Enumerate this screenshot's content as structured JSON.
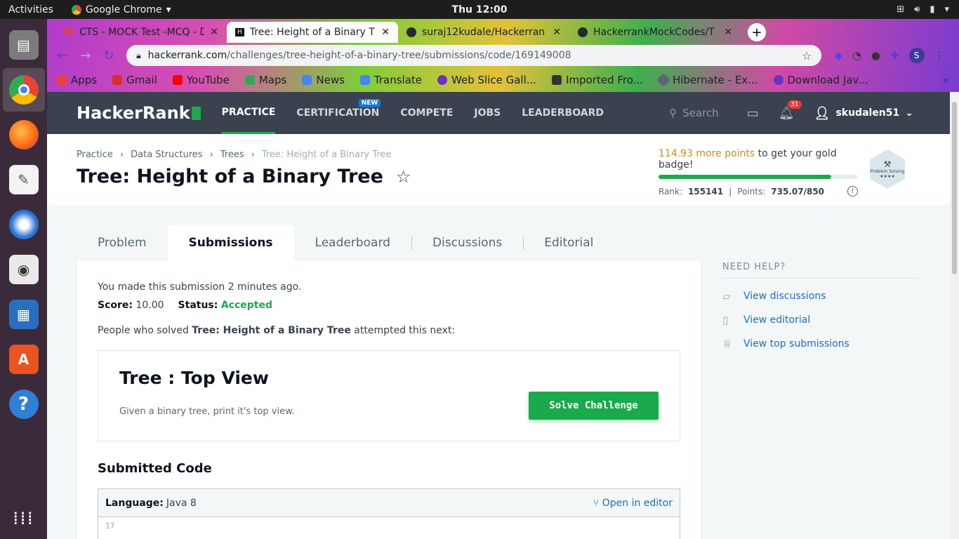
{
  "os": {
    "activities": "Activities",
    "app_name": "Google Chrome",
    "clock": "Thu 12:00"
  },
  "browser": {
    "tabs": [
      {
        "title": "CTS - MOCK Test -MCQ - D",
        "icon": "gmail-icon",
        "active": false
      },
      {
        "title": "Tree: Height of a Binary T",
        "icon": "hackerrank-icon",
        "active": true
      },
      {
        "title": "suraj12kudale/Hackerran",
        "icon": "github-icon",
        "active": false
      },
      {
        "title": "HackerrankMockCodes/T",
        "icon": "github-icon",
        "active": false
      }
    ],
    "url_host": "hackerrank.com",
    "url_path": "/challenges/tree-height-of-a-binary-tree/submissions/code/169149008",
    "profile_initial": "S",
    "bookmarks": [
      {
        "label": "Apps",
        "color": "#ea4335"
      },
      {
        "label": "Gmail",
        "color": "#d93025"
      },
      {
        "label": "YouTube",
        "color": "#ff0000"
      },
      {
        "label": "Maps",
        "color": "#34a853"
      },
      {
        "label": "News",
        "color": "#4285f4"
      },
      {
        "label": "Translate",
        "color": "#4285f4"
      },
      {
        "label": "Web Slice Gall...",
        "color": "#6a33c2"
      },
      {
        "label": "Imported Fro...",
        "color": "#333333"
      },
      {
        "label": "Hibernate - Ex...",
        "color": "#59666c"
      },
      {
        "label": "Download Jav...",
        "color": "#6a33c2"
      }
    ],
    "bookmarks_more": "»"
  },
  "hr": {
    "logo": "HackerRank",
    "nav": [
      {
        "label": "PRACTICE",
        "active": true
      },
      {
        "label": "CERTIFICATION",
        "badge": "NEW"
      },
      {
        "label": "COMPETE"
      },
      {
        "label": "JOBS"
      },
      {
        "label": "LEADERBOARD"
      }
    ],
    "search_placeholder": "Search",
    "notifications_count": "31",
    "username": "skudalen51",
    "breadcrumbs": [
      "Practice",
      "Data Structures",
      "Trees",
      "Tree: Height of a Binary Tree"
    ],
    "page_title": "Tree: Height of a Binary Tree",
    "badge_progress": {
      "points_needed": "114.93 more points",
      "suffix": " to get your gold badge!",
      "fraction": 0.865,
      "rank_label": "Rank:",
      "rank": "155141",
      "points_label": "Points:",
      "points": "735.07/850",
      "badge_name": "Problem Solving",
      "badge_stars": "★★★★"
    },
    "subtabs": [
      {
        "label": "Problem"
      },
      {
        "label": "Submissions",
        "active": true
      },
      {
        "label": "Leaderboard"
      },
      {
        "label": "Discussions"
      },
      {
        "label": "Editorial"
      }
    ],
    "submission": {
      "made_text": "You made this submission 2 minutes ago.",
      "score_label": "Score:",
      "score": "10.00",
      "status_label": "Status:",
      "status": "Accepted",
      "next_prefix": "People who solved ",
      "next_bold": "Tree: Height of a Binary Tree",
      "next_suffix": " attempted this next:"
    },
    "recommendation": {
      "title": "Tree : Top View",
      "desc": "Given a binary tree, print it's top view.",
      "button": "Solve Challenge"
    },
    "code": {
      "heading": "Submitted Code",
      "language_label": "Language:",
      "language": "Java 8",
      "open_editor": "Open in editor",
      "first_line_number": "17"
    },
    "help": {
      "title": "NEED HELP?",
      "links": [
        "View discussions",
        "View editorial",
        "View top submissions"
      ]
    }
  }
}
